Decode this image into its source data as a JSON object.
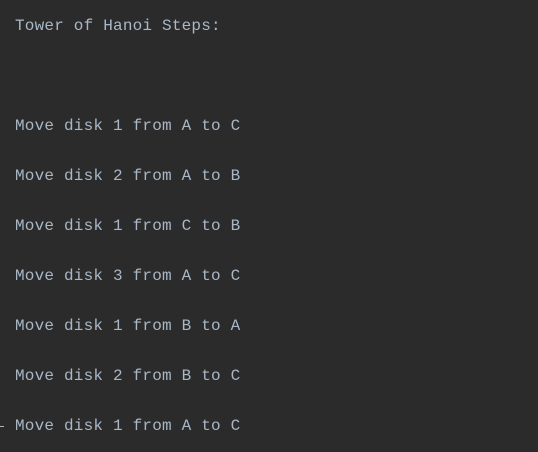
{
  "console": {
    "header": "Tower of Hanoi Steps:",
    "lines": [
      "Move disk 1 from A to C",
      "Move disk 2 from A to B",
      "Move disk 1 from C to B",
      "Move disk 3 from A to C",
      "Move disk 1 from B to A",
      "Move disk 2 from B to C",
      "Move disk 1 from A to C"
    ]
  }
}
